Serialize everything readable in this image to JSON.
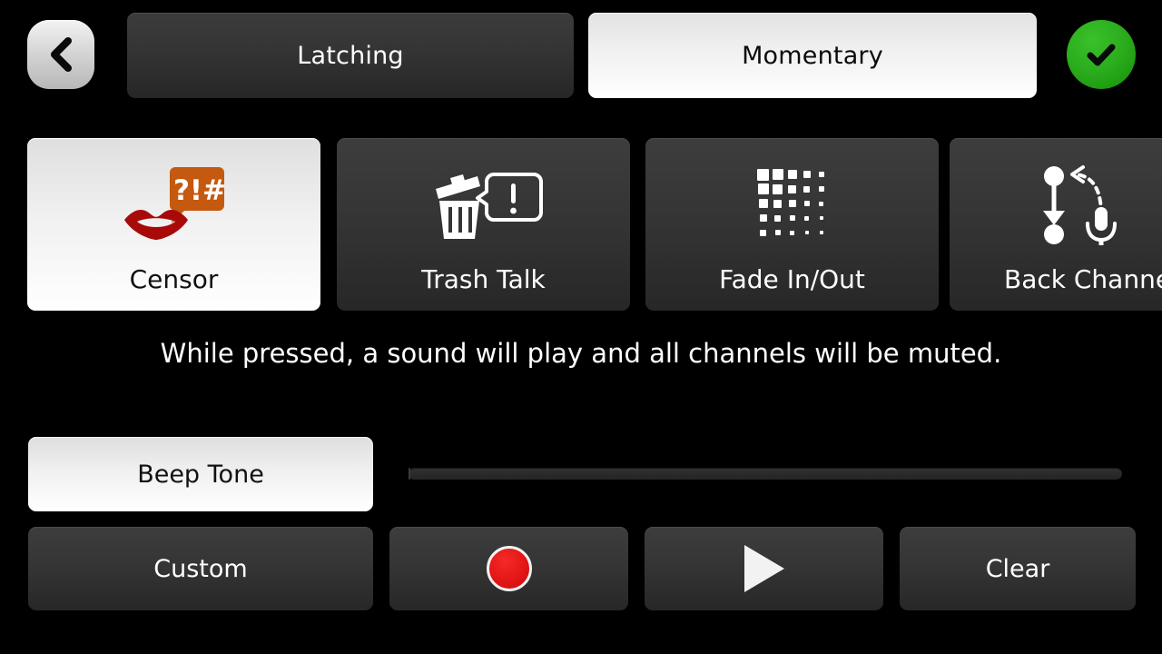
{
  "header": {
    "back_icon": "chevron-left-icon",
    "confirm_icon": "check-icon",
    "tabs": [
      {
        "label": "Latching",
        "active": false
      },
      {
        "label": "Momentary",
        "active": true
      }
    ]
  },
  "effects": {
    "tiles": [
      {
        "label": "Censor",
        "icon": "lips-censor-bubble-icon",
        "active": true,
        "bubble_text": "?!#"
      },
      {
        "label": "Trash Talk",
        "icon": "trash-can-speech-bubble-icon",
        "active": false
      },
      {
        "label": "Fade In/Out",
        "icon": "fade-grid-icon",
        "active": false
      },
      {
        "label": "Back Channel",
        "icon": "back-channel-mic-icon",
        "active": false
      }
    ]
  },
  "description": "While pressed, a sound will play and all channels will be muted.",
  "preset": {
    "sound_label": "Beep Tone",
    "slider_name": "volume-slider",
    "slider_value": 0
  },
  "transport": {
    "custom_label": "Custom",
    "record_label": "",
    "record_icon": "record-icon",
    "play_label": "",
    "play_icon": "play-icon",
    "clear_label": "Clear"
  },
  "colors": {
    "background": "#000000",
    "tile_inactive": "#353535",
    "tile_active": "#f0f0f0",
    "confirm_green": "#2cae1e",
    "record_red": "#e61717",
    "censor_bubble_orange": "#c4590f",
    "censor_lips_red": "#a80a0a"
  }
}
